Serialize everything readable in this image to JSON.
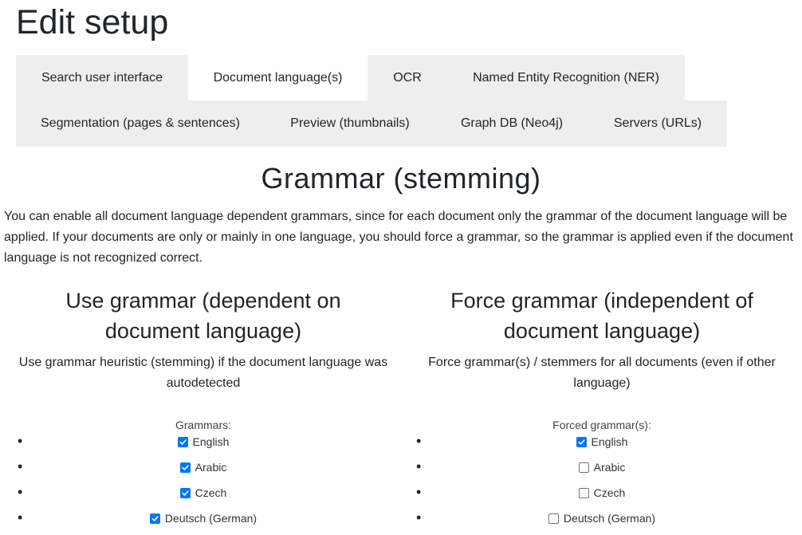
{
  "page": {
    "title": "Edit setup"
  },
  "tabs": {
    "row1": [
      {
        "label": "Search user interface",
        "active": false
      },
      {
        "label": "Document language(s)",
        "active": true
      },
      {
        "label": "OCR",
        "active": false
      },
      {
        "label": "Named Entity Recognition (NER)",
        "active": false
      }
    ],
    "row2": [
      {
        "label": "Segmentation (pages & sentences)",
        "active": false
      },
      {
        "label": "Preview (thumbnails)",
        "active": false
      },
      {
        "label": "Graph DB (Neo4j)",
        "active": false
      },
      {
        "label": "Servers (URLs)",
        "active": false
      }
    ]
  },
  "section": {
    "title": "Grammar (stemming)",
    "intro": "You can enable all document language dependent grammars, since for each document only the grammar of the document language will be applied. If your documents are only or mainly in one language, you should force a grammar, so the grammar is applied even if the document language is not recognized correct."
  },
  "use_grammar": {
    "title": "Use grammar (dependent on document language)",
    "description": "Use grammar heuristic (stemming) if the document language was autodetected",
    "list_label": "Grammars:",
    "items": [
      {
        "label": "English",
        "checked": true
      },
      {
        "label": "Arabic",
        "checked": true
      },
      {
        "label": "Czech",
        "checked": true
      },
      {
        "label": "Deutsch (German)",
        "checked": true
      }
    ]
  },
  "force_grammar": {
    "title": "Force grammar (independent of document language)",
    "description": "Force grammar(s) / stemmers for all documents (even if other language)",
    "list_label": "Forced grammar(s):",
    "items": [
      {
        "label": "English",
        "checked": true
      },
      {
        "label": "Arabic",
        "checked": false
      },
      {
        "label": "Czech",
        "checked": false
      },
      {
        "label": "Deutsch (German)",
        "checked": false
      }
    ]
  },
  "colors": {
    "accent": "#0075ff",
    "tab_bg": "#eeeeee",
    "text": "#212529"
  }
}
